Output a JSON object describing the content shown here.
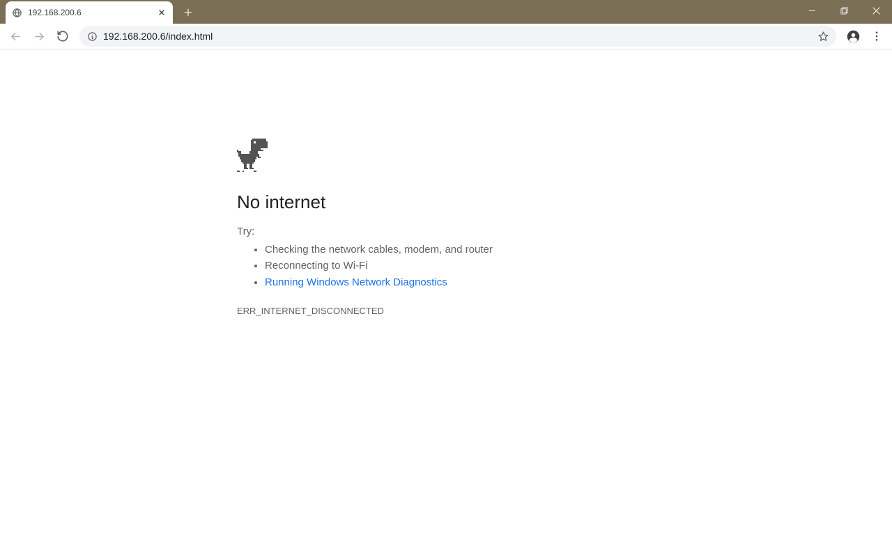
{
  "tab": {
    "title": "192.168.200.6"
  },
  "toolbar": {
    "url": "192.168.200.6/index.html"
  },
  "error": {
    "heading": "No internet",
    "try_label": "Try:",
    "suggestions": [
      "Checking the network cables, modem, and router",
      "Reconnecting to Wi-Fi"
    ],
    "diagnostics_link": "Running Windows Network Diagnostics",
    "code": "ERR_INTERNET_DISCONNECTED"
  }
}
